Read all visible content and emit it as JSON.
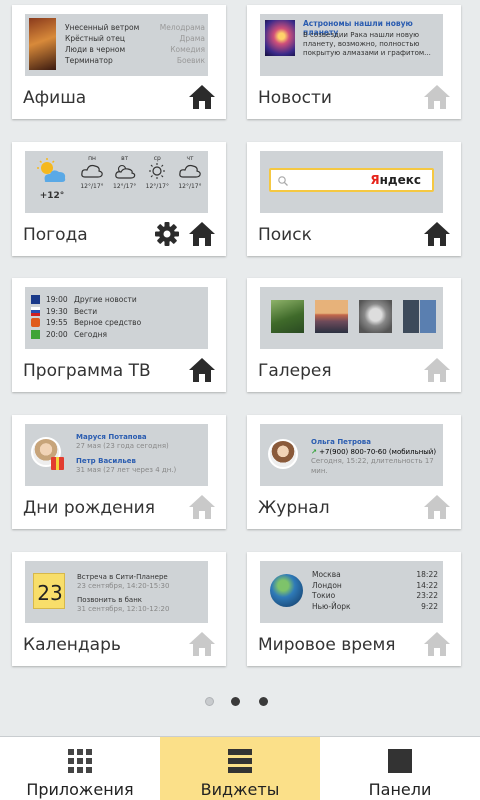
{
  "widgets": {
    "afisha": {
      "title": "Афиша",
      "movies": [
        {
          "name": "Унесенный ветром",
          "genre": "Мелодрама"
        },
        {
          "name": "Крёстный отец",
          "genre": "Драма"
        },
        {
          "name": "Люди в черном",
          "genre": "Комедия"
        },
        {
          "name": "Терминатор",
          "genre": "Боевик"
        }
      ]
    },
    "news": {
      "title": "Новости",
      "headline": "Астрономы нашли новую планету",
      "text": "В созвездии Рака нашли новую планету, возможно, полностью покрытую алмазами и графитом..."
    },
    "weather": {
      "title": "Погода",
      "current_temp": "+12°",
      "days": [
        {
          "day": "пн",
          "temp": "12°/17°"
        },
        {
          "day": "вт",
          "temp": "12°/17°"
        },
        {
          "day": "ср",
          "temp": "12°/17°"
        },
        {
          "day": "чт",
          "temp": "12°/17°"
        }
      ]
    },
    "search": {
      "title": "Поиск",
      "logo_first": "Я",
      "logo_rest": "ндекс"
    },
    "tv": {
      "title": "Программа ТВ",
      "programs": [
        {
          "time": "19:00",
          "name": "Другие новости"
        },
        {
          "time": "19:30",
          "name": "Вести"
        },
        {
          "time": "19:55",
          "name": "Верное средство"
        },
        {
          "time": "20:00",
          "name": "Сегодня"
        }
      ]
    },
    "gallery": {
      "title": "Галерея"
    },
    "birthdays": {
      "title": "Дни рождения",
      "people": [
        {
          "name": "Маруся Потапова",
          "date": "27 мая (23 года сегодня)"
        },
        {
          "name": "Петр Васильев",
          "date": "31 мая (27 лет через 4 дн.)"
        }
      ]
    },
    "journal": {
      "title": "Журнал",
      "name": "Ольга Петрова",
      "phone": "+7(900) 800-70-60 (мобильный)",
      "details": "Сегодня, 15:22, длительность 17 мин."
    },
    "calendar": {
      "title": "Календарь",
      "day": "23",
      "events": [
        {
          "name": "Встреча в Сити-Планере",
          "time": "23 сентября, 14:20-15:30"
        },
        {
          "name": "Позвонить в банк",
          "time": "31 сентября, 12:10-12:20"
        }
      ]
    },
    "worldtime": {
      "title": "Мировое время",
      "cities": [
        {
          "city": "Москва",
          "time": "18:22"
        },
        {
          "city": "Лондон",
          "time": "14:22"
        },
        {
          "city": "Токио",
          "time": "23:22"
        },
        {
          "city": "Нью-Йорк",
          "time": "9:22"
        }
      ]
    }
  },
  "pager": {
    "pages": 3,
    "current": 1
  },
  "tabs": [
    {
      "label": "Приложения",
      "icon": "grid-icon"
    },
    {
      "label": "Виджеты",
      "icon": "widgets-icon"
    },
    {
      "label": "Панели",
      "icon": "panel-icon"
    }
  ],
  "colors": {
    "active_tab": "#fbe089",
    "home_active": "#2b2b2b",
    "home_inactive": "#c9c9c9",
    "link_blue": "#2a5cb0"
  }
}
